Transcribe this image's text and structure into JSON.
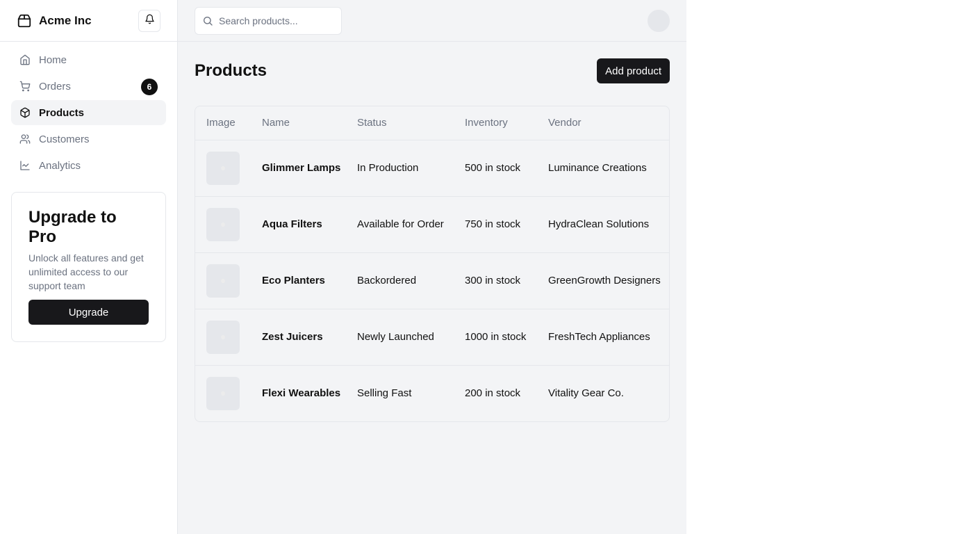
{
  "brand": {
    "name": "Acme Inc"
  },
  "nav": {
    "items": [
      {
        "label": "Home",
        "icon": "home-icon"
      },
      {
        "label": "Orders",
        "icon": "cart-icon",
        "badge": "6"
      },
      {
        "label": "Products",
        "icon": "package-icon",
        "active": true
      },
      {
        "label": "Customers",
        "icon": "users-icon"
      },
      {
        "label": "Analytics",
        "icon": "line-chart-icon"
      }
    ]
  },
  "upgrade": {
    "title": "Upgrade to Pro",
    "description": "Unlock all features and get unlimited access to our support team",
    "button": "Upgrade"
  },
  "search": {
    "placeholder": "Search products..."
  },
  "page": {
    "title": "Products",
    "add_button": "Add product"
  },
  "table": {
    "headers": [
      "Image",
      "Name",
      "Status",
      "Inventory",
      "Vendor"
    ],
    "rows": [
      {
        "name": "Glimmer Lamps",
        "status": "In Production",
        "inventory": "500 in stock",
        "vendor": "Luminance Creations"
      },
      {
        "name": "Aqua Filters",
        "status": "Available for Order",
        "inventory": "750 in stock",
        "vendor": "HydraClean Solutions"
      },
      {
        "name": "Eco Planters",
        "status": "Backordered",
        "inventory": "300 in stock",
        "vendor": "GreenGrowth Designers"
      },
      {
        "name": "Zest Juicers",
        "status": "Newly Launched",
        "inventory": "1000 in stock",
        "vendor": "FreshTech Appliances"
      },
      {
        "name": "Flexi Wearables",
        "status": "Selling Fast",
        "inventory": "200 in stock",
        "vendor": "Vitality Gear Co."
      }
    ]
  },
  "colors": {
    "accent": "#18181b",
    "muted": "#6b7280",
    "border": "#e5e7eb",
    "main_bg": "#f3f4f6"
  }
}
